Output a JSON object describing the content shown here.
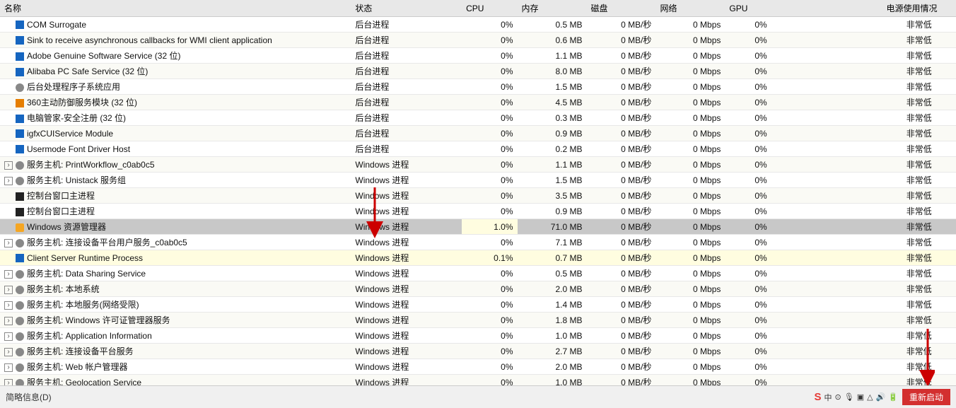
{
  "header": {
    "cols": [
      "名称",
      "状态",
      "CPU",
      "内存",
      "磁盘",
      "网络",
      "GPU",
      "",
      "电源使用情况"
    ]
  },
  "rows": [
    {
      "indent": 0,
      "icon": "blue",
      "expandable": false,
      "name": "COM Surrogate",
      "type": "后台进程",
      "cpu": "0%",
      "mem": "0.5 MB",
      "disk": "0 MB/秒",
      "net": "0 Mbps",
      "gpu": "0%",
      "extra": "",
      "power": "非常低",
      "bg": "normal"
    },
    {
      "indent": 0,
      "icon": "blue",
      "expandable": false,
      "name": "Sink to receive asynchronous callbacks for WMI client application",
      "type": "后台进程",
      "cpu": "0%",
      "mem": "0.6 MB",
      "disk": "0 MB/秒",
      "net": "0 Mbps",
      "gpu": "0%",
      "extra": "",
      "power": "非常低",
      "bg": "normal"
    },
    {
      "indent": 0,
      "icon": "blue",
      "expandable": false,
      "name": "Adobe Genuine Software Service (32 位)",
      "type": "后台进程",
      "cpu": "0%",
      "mem": "1.1 MB",
      "disk": "0 MB/秒",
      "net": "0 Mbps",
      "gpu": "0%",
      "extra": "",
      "power": "非常低",
      "bg": "normal"
    },
    {
      "indent": 0,
      "icon": "blue",
      "expandable": false,
      "name": "Alibaba PC Safe Service (32 位)",
      "type": "后台进程",
      "cpu": "0%",
      "mem": "8.0 MB",
      "disk": "0 MB/秒",
      "net": "0 Mbps",
      "gpu": "0%",
      "extra": "",
      "power": "非常低",
      "bg": "normal"
    },
    {
      "indent": 0,
      "icon": "gear",
      "expandable": false,
      "name": "后台处理程序子系统应用",
      "type": "后台进程",
      "cpu": "0%",
      "mem": "1.5 MB",
      "disk": "0 MB/秒",
      "net": "0 Mbps",
      "gpu": "0%",
      "extra": "",
      "power": "非常低",
      "bg": "normal"
    },
    {
      "indent": 0,
      "icon": "orange",
      "expandable": false,
      "name": "360主动防御服务模块 (32 位)",
      "type": "后台进程",
      "cpu": "0%",
      "mem": "4.5 MB",
      "disk": "0 MB/秒",
      "net": "0 Mbps",
      "gpu": "0%",
      "extra": "",
      "power": "非常低",
      "bg": "normal"
    },
    {
      "indent": 0,
      "icon": "blue",
      "expandable": false,
      "name": "电脑管家-安全注册 (32 位)",
      "type": "后台进程",
      "cpu": "0%",
      "mem": "0.3 MB",
      "disk": "0 MB/秒",
      "net": "0 Mbps",
      "gpu": "0%",
      "extra": "",
      "power": "非常低",
      "bg": "normal"
    },
    {
      "indent": 0,
      "icon": "blue",
      "expandable": false,
      "name": "igfxCUIService Module",
      "type": "后台进程",
      "cpu": "0%",
      "mem": "0.9 MB",
      "disk": "0 MB/秒",
      "net": "0 Mbps",
      "gpu": "0%",
      "extra": "",
      "power": "非常低",
      "bg": "normal"
    },
    {
      "indent": 0,
      "icon": "blue",
      "expandable": false,
      "name": "Usermode Font Driver Host",
      "type": "后台进程",
      "cpu": "0%",
      "mem": "0.2 MB",
      "disk": "0 MB/秒",
      "net": "0 Mbps",
      "gpu": "0%",
      "extra": "",
      "power": "非常低",
      "bg": "normal"
    },
    {
      "indent": 0,
      "icon": "gear",
      "expandable": true,
      "name": "服务主机: PrintWorkflow_c0ab0c5",
      "type": "Windows 进程",
      "cpu": "0%",
      "mem": "1.1 MB",
      "disk": "0 MB/秒",
      "net": "0 Mbps",
      "gpu": "0%",
      "extra": "",
      "power": "非常低",
      "bg": "normal"
    },
    {
      "indent": 0,
      "icon": "gear",
      "expandable": true,
      "name": "服务主机: Unistack 服务组",
      "type": "Windows 进程",
      "cpu": "0%",
      "mem": "1.5 MB",
      "disk": "0 MB/秒",
      "net": "0 Mbps",
      "gpu": "0%",
      "extra": "",
      "power": "非常低",
      "bg": "normal"
    },
    {
      "indent": 0,
      "icon": "black",
      "expandable": false,
      "name": "控制台窗口主进程",
      "type": "Windows 进程",
      "cpu": "0%",
      "mem": "3.5 MB",
      "disk": "0 MB/秒",
      "net": "0 Mbps",
      "gpu": "0%",
      "extra": "",
      "power": "非常低",
      "bg": "normal"
    },
    {
      "indent": 0,
      "icon": "black",
      "expandable": false,
      "name": "控制台窗口主进程",
      "type": "Windows 进程",
      "cpu": "0%",
      "mem": "0.9 MB",
      "disk": "0 MB/秒",
      "net": "0 Mbps",
      "gpu": "0%",
      "extra": "",
      "power": "非常低",
      "bg": "normal"
    },
    {
      "indent": 0,
      "icon": "explorer",
      "expandable": false,
      "name": "Windows 资源管理器",
      "type": "Windows 进程",
      "cpu": "1.0%",
      "mem": "71.0 MB",
      "disk": "0 MB/秒",
      "net": "0 Mbps",
      "gpu": "0%",
      "extra": "",
      "power": "非常低",
      "bg": "highlight"
    },
    {
      "indent": 0,
      "icon": "gear",
      "expandable": true,
      "name": "服务主机: 连接设备平台用户服务_c0ab0c5",
      "type": "Windows 进程",
      "cpu": "0%",
      "mem": "7.1 MB",
      "disk": "0 MB/秒",
      "net": "0 Mbps",
      "gpu": "0%",
      "extra": "",
      "power": "非常低",
      "bg": "normal"
    },
    {
      "indent": 0,
      "icon": "blue",
      "expandable": false,
      "name": "Client Server Runtime Process",
      "type": "Windows 进程",
      "cpu": "0.1%",
      "mem": "0.7 MB",
      "disk": "0 MB/秒",
      "net": "0 Mbps",
      "gpu": "0%",
      "extra": "",
      "power": "非常低",
      "bg": "yellow"
    },
    {
      "indent": 0,
      "icon": "gear",
      "expandable": true,
      "name": "服务主机: Data Sharing Service",
      "type": "Windows 进程",
      "cpu": "0%",
      "mem": "0.5 MB",
      "disk": "0 MB/秒",
      "net": "0 Mbps",
      "gpu": "0%",
      "extra": "",
      "power": "非常低",
      "bg": "normal"
    },
    {
      "indent": 0,
      "icon": "gear",
      "expandable": true,
      "name": "服务主机: 本地系统",
      "type": "Windows 进程",
      "cpu": "0%",
      "mem": "2.0 MB",
      "disk": "0 MB/秒",
      "net": "0 Mbps",
      "gpu": "0%",
      "extra": "",
      "power": "非常低",
      "bg": "normal"
    },
    {
      "indent": 0,
      "icon": "gear",
      "expandable": true,
      "name": "服务主机: 本地服务(网络受限)",
      "type": "Windows 进程",
      "cpu": "0%",
      "mem": "1.4 MB",
      "disk": "0 MB/秒",
      "net": "0 Mbps",
      "gpu": "0%",
      "extra": "",
      "power": "非常低",
      "bg": "normal"
    },
    {
      "indent": 0,
      "icon": "gear",
      "expandable": true,
      "name": "服务主机: Windows 许可证管理器服务",
      "type": "Windows 进程",
      "cpu": "0%",
      "mem": "1.8 MB",
      "disk": "0 MB/秒",
      "net": "0 Mbps",
      "gpu": "0%",
      "extra": "",
      "power": "非常低",
      "bg": "normal"
    },
    {
      "indent": 0,
      "icon": "gear",
      "expandable": true,
      "name": "服务主机: Application Information",
      "type": "Windows 进程",
      "cpu": "0%",
      "mem": "1.0 MB",
      "disk": "0 MB/秒",
      "net": "0 Mbps",
      "gpu": "0%",
      "extra": "",
      "power": "非常低",
      "bg": "normal"
    },
    {
      "indent": 0,
      "icon": "gear",
      "expandable": true,
      "name": "服务主机: 连接设备平台服务",
      "type": "Windows 进程",
      "cpu": "0%",
      "mem": "2.7 MB",
      "disk": "0 MB/秒",
      "net": "0 Mbps",
      "gpu": "0%",
      "extra": "",
      "power": "非常低",
      "bg": "normal"
    },
    {
      "indent": 0,
      "icon": "gear",
      "expandable": true,
      "name": "服务主机: Web 帐户管理器",
      "type": "Windows 进程",
      "cpu": "0%",
      "mem": "2.0 MB",
      "disk": "0 MB/秒",
      "net": "0 Mbps",
      "gpu": "0%",
      "extra": "",
      "power": "非常低",
      "bg": "normal"
    },
    {
      "indent": 0,
      "icon": "gear",
      "expandable": true,
      "name": "服务主机: Geolocation Service",
      "type": "Windows 进程",
      "cpu": "0%",
      "mem": "1.0 MB",
      "disk": "0 MB/秒",
      "net": "0 Mbps",
      "gpu": "0%",
      "extra": "",
      "power": "非常低",
      "bg": "normal"
    }
  ],
  "statusbar": {
    "left_label": "简略信息(D)",
    "restart_label": "重新启动"
  },
  "tray": {
    "items": [
      "S",
      "中",
      "♦",
      "♪",
      "⊞",
      "△",
      "⬛",
      "🔊"
    ]
  }
}
